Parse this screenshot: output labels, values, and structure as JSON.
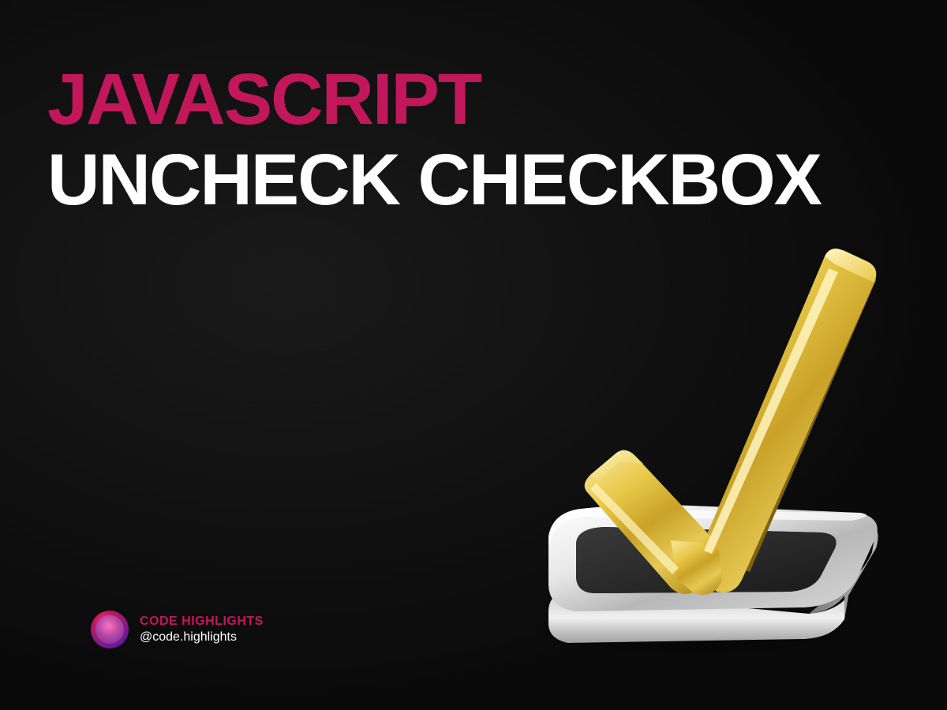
{
  "title": {
    "line1": "JAVASCRIPT",
    "line2": "UNCHECK CHECKBOX"
  },
  "attribution": {
    "brand": "CODE HIGHLIGHTS",
    "handle": "@code.highlights"
  },
  "graphic": {
    "name": "3d-checkbox-checkmark",
    "checkmark_color": "#d4af37",
    "box_color": "#c0c0c0"
  },
  "colors": {
    "accent": "#c2185b",
    "background": "#0a0a0a",
    "text": "#ffffff"
  }
}
